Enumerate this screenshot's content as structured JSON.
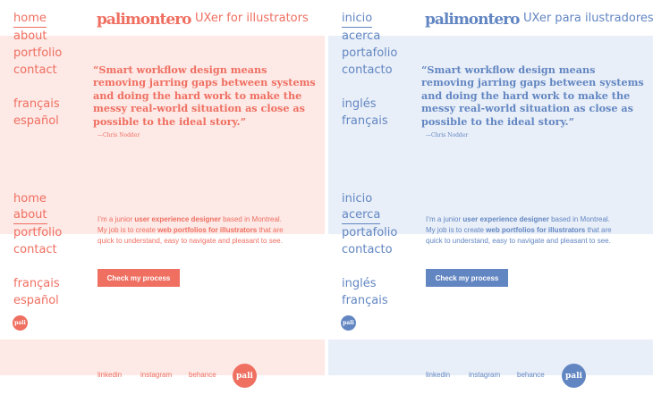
{
  "colors": {
    "coral": "#ef6f61",
    "coral_bg": "#fde9e6",
    "blue": "#6286c2",
    "blue_bg": "#e9eff8"
  },
  "english": {
    "nav_top": [
      "home",
      "about",
      "portfolio",
      "contact"
    ],
    "nav_lang": [
      "français",
      "español"
    ],
    "logo": "palimontero",
    "tagline": "UXer for illustrators",
    "quote": "“Smart workflow design means removing jarring gaps between systems and doing the hard work to make the messy real-world situation as close as possible to the ideal story.”",
    "quote_author": "—Chris Nodder",
    "intro": {
      "p1": "I’m a junior ",
      "b1": "user experience designer",
      "p2": " based in Montreal. My job is to create ",
      "b2": "web portfolios for illustrators",
      "p3": " that are quick to understand, easy to navigate and pleasant to see."
    },
    "cta": "Check my process",
    "badge": "pali",
    "footer_links": [
      "linkedin",
      "instagram",
      "behance"
    ]
  },
  "spanish": {
    "nav_top": [
      "inicio",
      "acerca",
      "portafolio",
      "contacto"
    ],
    "nav_lang": [
      "inglés",
      "français"
    ],
    "logo": "palimontero",
    "tagline": "UXer para ilustradores",
    "quote": "“Smart workflow design means removing jarring gaps between systems and doing the hard work to make the messy real-world situation as close as possible to the ideal story.”",
    "quote_author": "—Chris Nodder",
    "intro": {
      "p1": "I’m a junior ",
      "b1": "user experience designer",
      "p2": " based in Montreal. My job is to create ",
      "b2": "web portfolios for illustrators",
      "p3": " that are quick to understand, easy to navigate and pleasant to see."
    },
    "cta": "Check my process",
    "badge": "pali",
    "footer_links": [
      "linkedin",
      "instagram",
      "behance"
    ]
  }
}
